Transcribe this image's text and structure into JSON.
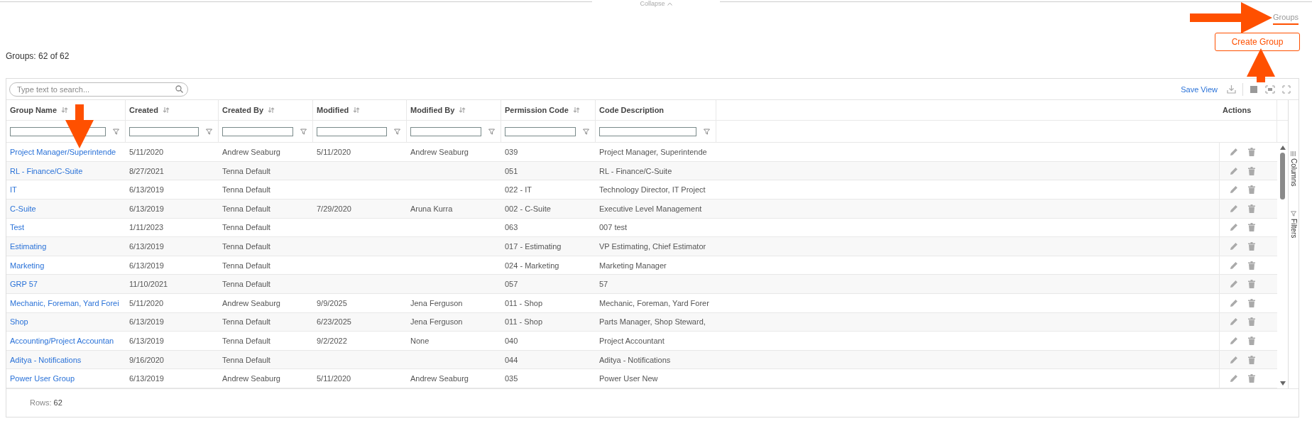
{
  "collapse_tab": {
    "label": "Collapse"
  },
  "tabs": [
    {
      "label": "Groups",
      "selected": true
    }
  ],
  "create_button": {
    "label": "Create Group"
  },
  "summary": "Groups: 62 of 62",
  "toolbar": {
    "search": {
      "placeholder": "Type text to search..."
    },
    "save_view": "Save View"
  },
  "columns": [
    {
      "label": "Group Name",
      "sortable": true
    },
    {
      "label": "Created",
      "sortable": true
    },
    {
      "label": "Created By",
      "sortable": true
    },
    {
      "label": "Modified",
      "sortable": true
    },
    {
      "label": "Modified By",
      "sortable": true
    },
    {
      "label": "Permission Code",
      "sortable": true
    },
    {
      "label": "Code Description",
      "sortable": false
    }
  ],
  "actions_column": {
    "label": "Actions"
  },
  "side_tabs": [
    {
      "label": "Columns",
      "kind": "columns"
    },
    {
      "label": "Filters",
      "kind": "filters"
    }
  ],
  "rows": [
    {
      "cells": [
        "Project Manager/Superintende",
        "5/11/2020",
        "Andrew Seaburg",
        "5/11/2020",
        "Andrew Seaburg",
        "039",
        "Project Manager, Superintende"
      ]
    },
    {
      "cells": [
        "RL - Finance/C-Suite",
        "8/27/2021",
        "Tenna Default",
        null,
        null,
        "051",
        "RL - Finance/C-Suite"
      ]
    },
    {
      "cells": [
        "IT",
        "6/13/2019",
        "Tenna Default",
        null,
        null,
        "022 - IT",
        "Technology Director, IT Project"
      ]
    },
    {
      "cells": [
        "C-Suite",
        "6/13/2019",
        "Tenna Default",
        "7/29/2020",
        "Aruna Kurra",
        "002 - C-Suite",
        "Executive Level Management"
      ]
    },
    {
      "cells": [
        "Test",
        "1/11/2023",
        "Tenna Default",
        null,
        null,
        "063",
        "007 test"
      ]
    },
    {
      "cells": [
        "Estimating",
        "6/13/2019",
        "Tenna Default",
        null,
        null,
        "017 - Estimating",
        "VP Estimating, Chief Estimator"
      ]
    },
    {
      "cells": [
        "Marketing",
        "6/13/2019",
        "Tenna Default",
        null,
        null,
        "024 - Marketing",
        "Marketing Manager"
      ]
    },
    {
      "cells": [
        "GRP 57",
        "11/10/2021",
        "Tenna Default",
        null,
        null,
        "057",
        "57"
      ]
    },
    {
      "cells": [
        "Mechanic, Foreman, Yard Forei",
        "5/11/2020",
        "Andrew Seaburg",
        "9/9/2025",
        "Jena Ferguson",
        "011 - Shop",
        "Mechanic, Foreman, Yard Forer"
      ]
    },
    {
      "cells": [
        "Shop",
        "6/13/2019",
        "Tenna Default",
        "6/23/2025",
        "Jena Ferguson",
        "011 - Shop",
        "Parts Manager, Shop Steward,"
      ]
    },
    {
      "cells": [
        "Accounting/Project Accountan",
        "6/13/2019",
        "Tenna Default",
        "9/2/2022",
        "None",
        "040",
        "Project Accountant"
      ]
    },
    {
      "cells": [
        "Aditya - Notifications",
        "9/16/2020",
        "Tenna Default",
        null,
        null,
        "044",
        "Aditya - Notifications"
      ]
    },
    {
      "cells": [
        "Power User Group",
        "6/13/2019",
        "Andrew Seaburg",
        "5/11/2020",
        "Andrew Seaburg",
        "035",
        "Power User New"
      ]
    }
  ],
  "footer": {
    "label": "Rows:",
    "value": "62"
  }
}
